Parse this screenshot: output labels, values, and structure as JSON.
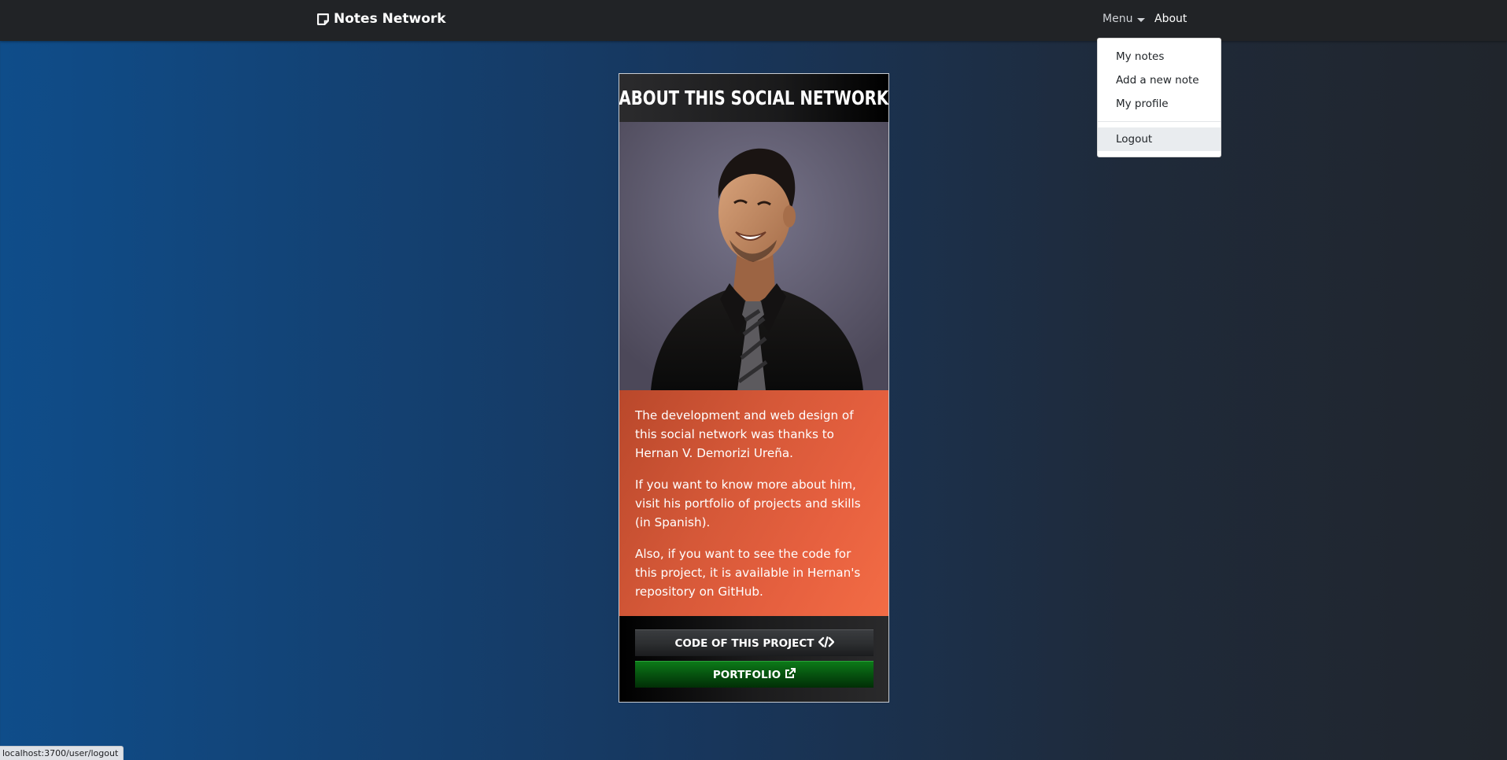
{
  "navbar": {
    "brand": "Notes Network",
    "menu_label": "Menu",
    "about_label": "About"
  },
  "dropdown": {
    "items": [
      {
        "label": "My notes"
      },
      {
        "label": "Add a new note"
      },
      {
        "label": "My profile"
      }
    ],
    "logout_label": "Logout"
  },
  "card": {
    "title": "ABOUT THIS SOCIAL NETWORK",
    "paragraphs": [
      "The development and web design of this social network was thanks to Hernan V. Demorizi Ureña.",
      "If you want to know more about him, visit his portfolio of projects and skills (in Spanish).",
      "Also, if you want to see the code for this project, it is available in Hernan's repository on GitHub."
    ],
    "code_button": "CODE OF THIS PROJECT",
    "portfolio_button": "PORTFOLIO"
  },
  "status_bar": {
    "url": "localhost:3700/user/logout"
  },
  "icons": {
    "brand": "note-icon",
    "code": "code-icon",
    "external": "external-link-icon"
  },
  "colors": {
    "navbar": "#212326",
    "card_body": "#e6603f",
    "portfolio_button": "#06520f"
  }
}
